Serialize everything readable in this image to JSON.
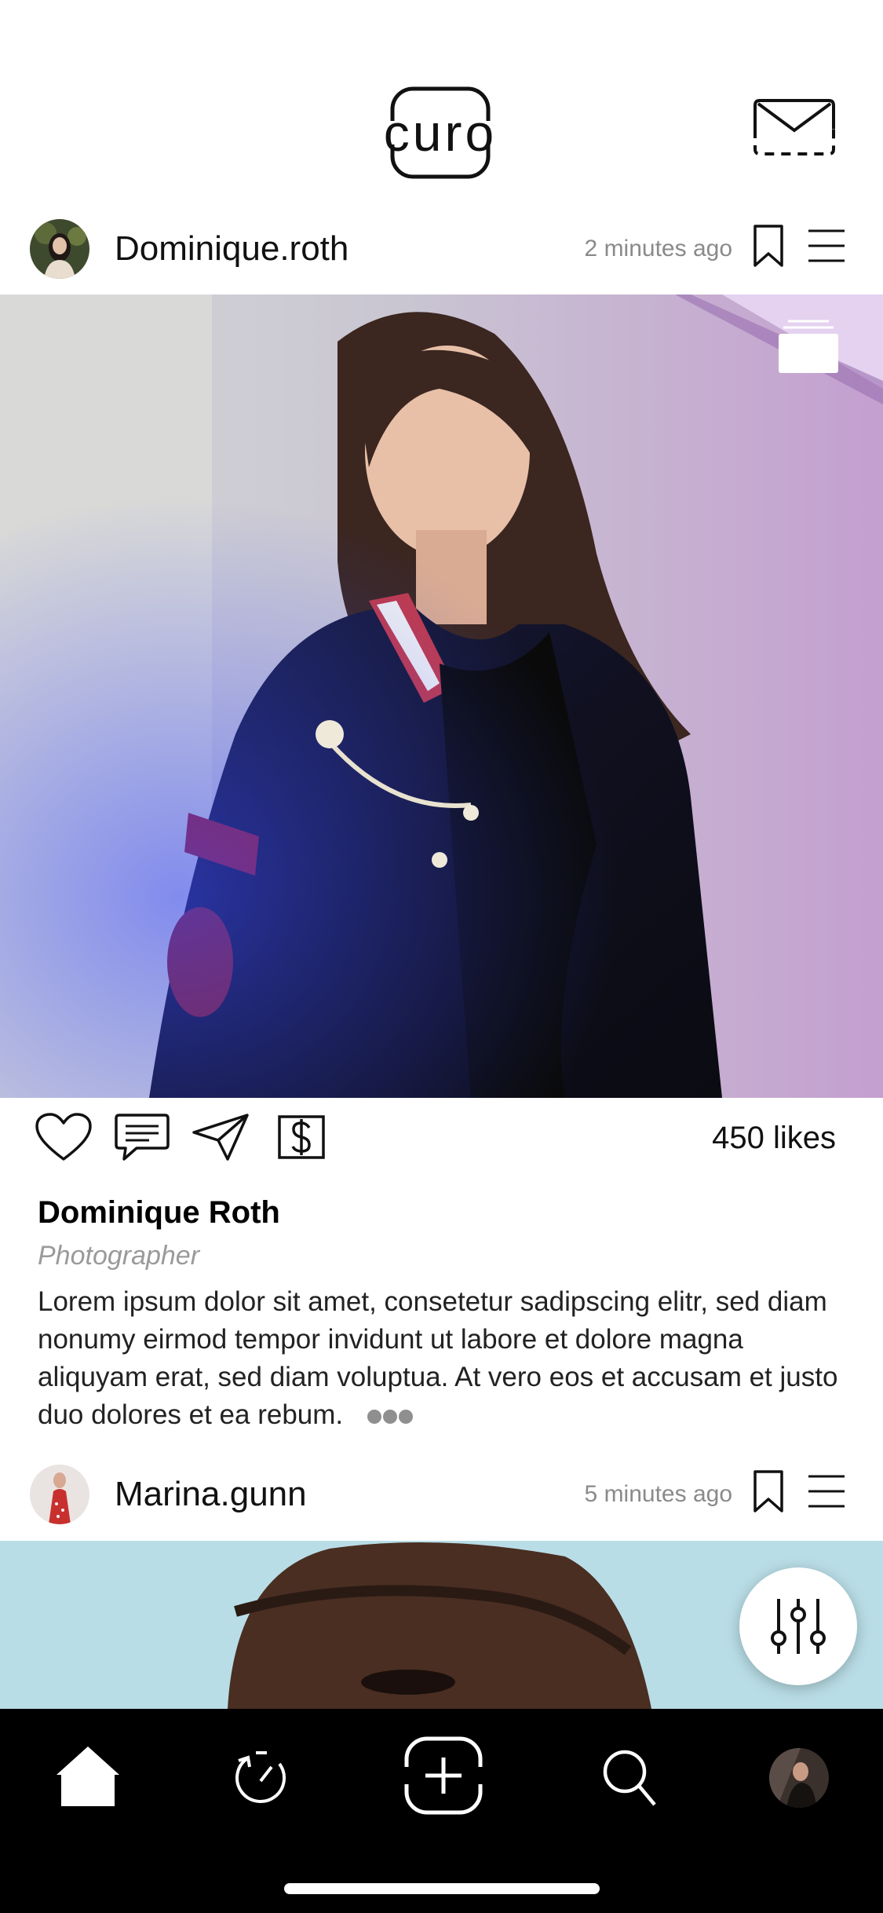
{
  "app": {
    "logo_text": "curo"
  },
  "posts": [
    {
      "username": "Dominique.roth",
      "time": "2 minutes ago",
      "likes": "450 likes",
      "author_name": "Dominique Roth",
      "author_role": "Photographer",
      "caption": "Lorem ipsum dolor sit amet, consetetur sadipscing elitr, sed diam nonumy eirmod tempor invidunt ut labore et dolore magna aliquyam erat, sed diam voluptua. At vero eos et accusam et justo duo dolores et ea rebum."
    },
    {
      "username": "Marina.gunn",
      "time": "5 minutes ago"
    }
  ],
  "icons": {
    "header": [
      "curo-logo",
      "mail-icon"
    ],
    "post_header": [
      "bookmark-icon",
      "menu-icon"
    ],
    "actions": [
      "heart-icon",
      "comment-icon",
      "send-icon",
      "dollar-icon"
    ],
    "tabs": [
      "home-icon",
      "activity-icon",
      "create-icon",
      "search-icon",
      "profile-avatar"
    ],
    "fab": "filter-sliders-icon",
    "media": "multiple-photos-icon",
    "more": "more-dots-icon"
  },
  "colors": {
    "background": "#ffffff",
    "text": "#111111",
    "muted": "#8a8a8a",
    "tabbar": "#000000"
  }
}
